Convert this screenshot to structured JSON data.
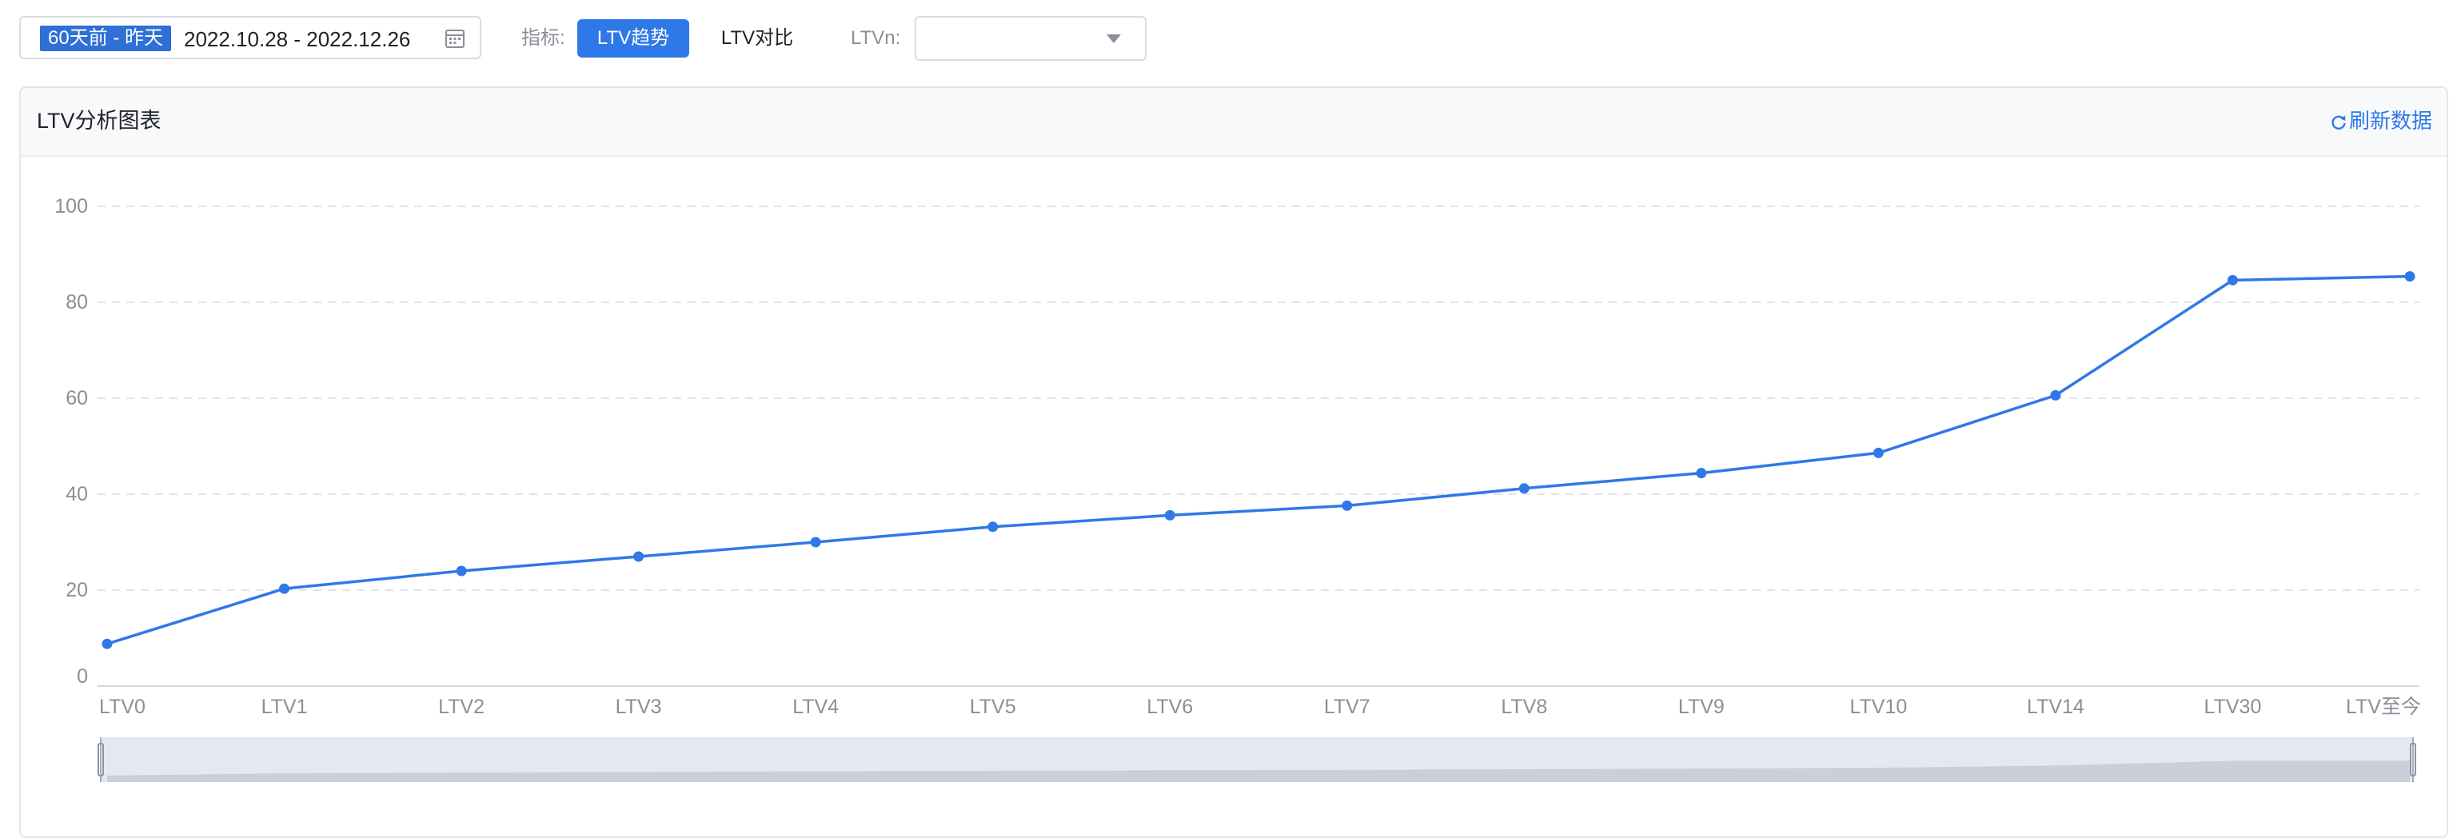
{
  "filter": {
    "date_preset": "60天前 - 昨天",
    "date_range": "2022.10.28 - 2022.12.26",
    "metric_label": "指标:",
    "metric_options": [
      "LTV趋势",
      "LTV对比"
    ],
    "metric_selected": "LTV趋势",
    "ltvn_label": "LTVn:",
    "ltvn_value": ""
  },
  "panel": {
    "title": "LTV分析图表",
    "refresh_label": "刷新数据"
  },
  "chart_data": {
    "type": "line",
    "title": "",
    "xlabel": "",
    "ylabel": "",
    "categories": [
      "LTV0",
      "LTV1",
      "LTV2",
      "LTV3",
      "LTV4",
      "LTV5",
      "LTV6",
      "LTV7",
      "LTV8",
      "LTV9",
      "LTV10",
      "LTV14",
      "LTV30",
      "LTV至今"
    ],
    "series": [
      {
        "values": [
          8.8,
          20.3,
          24.0,
          27.0,
          30.0,
          33.2,
          35.6,
          37.6,
          41.2,
          44.4,
          48.6,
          60.6,
          84.6,
          85.4
        ]
      }
    ],
    "ylim": [
      0,
      100
    ],
    "yticks": [
      0,
      20,
      40,
      60,
      80,
      100
    ],
    "grid": "horizontal dashed",
    "line_color": "#2f78e8",
    "data_zoom": "slider below x-axis, full range selected"
  }
}
